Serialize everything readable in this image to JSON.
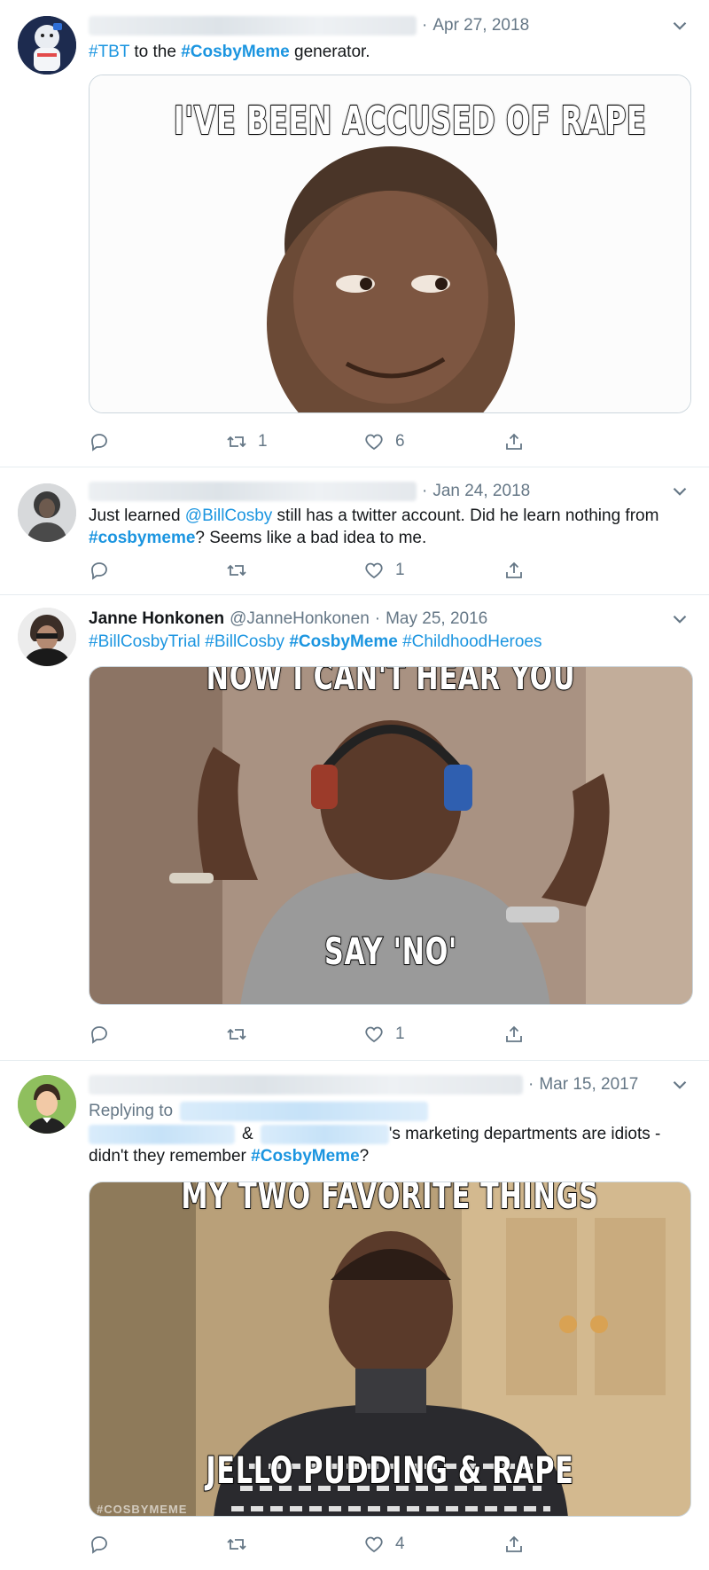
{
  "tweets": [
    {
      "date": "Apr 27, 2018",
      "text": {
        "t1": "#TBT",
        "t2": " to the ",
        "t3": "#CosbyMeme",
        "t4": " generator."
      },
      "media_caption_top": "I'VE BEEN ACCUSED OF RAPE",
      "actions": {
        "reply": "",
        "retweet": "1",
        "like": "6"
      }
    },
    {
      "date": "Jan 24, 2018",
      "text": {
        "t1": "Just learned ",
        "t2": "@BillCosby",
        "t3": " still has a twitter account. Did he learn nothing from ",
        "t4": "#cosbymeme",
        "t5": "? Seems like a bad idea to me."
      },
      "actions": {
        "reply": "",
        "retweet": "",
        "like": "1"
      }
    },
    {
      "name": "Janne Honkonen",
      "handle": "@JanneHonkonen",
      "date": "May 25, 2016",
      "text": {
        "t1": "#BillCosbyTrial",
        "t2": "#BillCosby",
        "t3": "#CosbyMeme",
        "t4": "#ChildhoodHeroes"
      },
      "media_caption_top": "NOW I CAN'T HEAR YOU",
      "media_caption_bottom": "SAY 'NO'",
      "actions": {
        "reply": "",
        "retweet": "",
        "like": "1"
      }
    },
    {
      "date": "Mar 15, 2017",
      "replying_to": "Replying to",
      "text": {
        "t1": "&",
        "t2": "'s marketing departments are idiots -",
        "t3": "didn't they remember ",
        "t4": "#CosbyMeme",
        "t5": "?"
      },
      "media_caption_top": "MY TWO FAVORITE THINGS",
      "media_caption_bottom": "JELLO PUDDING & RAPE",
      "media_watermark": "#COSBYMEME",
      "actions": {
        "reply": "",
        "retweet": "",
        "like": "4"
      }
    }
  ],
  "colors": {
    "link": "#1b95e0",
    "muted": "#657786",
    "border": "#e6ecf0"
  },
  "icons": [
    "reply-icon",
    "retweet-icon",
    "like-icon",
    "share-icon",
    "chevron-down-icon"
  ]
}
